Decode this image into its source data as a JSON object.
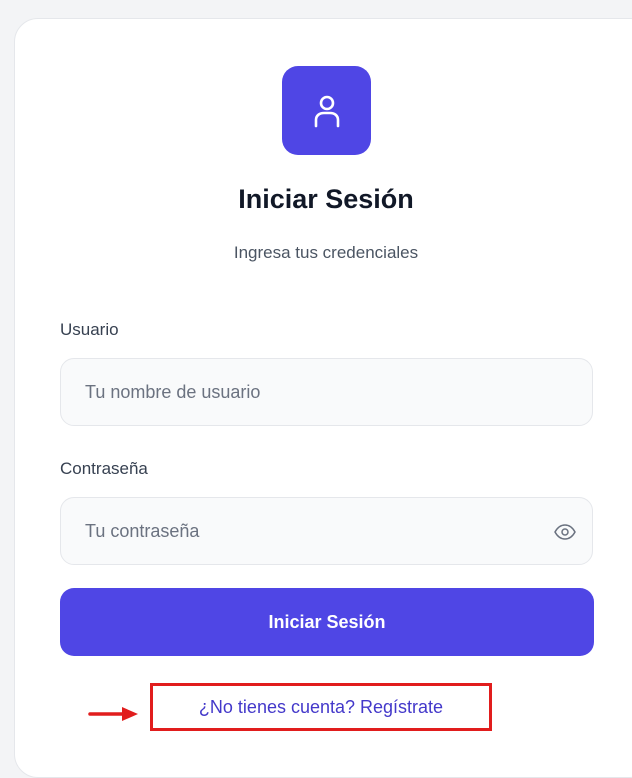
{
  "header": {
    "icon": "user-icon",
    "title": "Iniciar Sesión",
    "subtitle": "Ingresa tus credenciales"
  },
  "form": {
    "username": {
      "label": "Usuario",
      "placeholder": "Tu nombre de usuario",
      "value": ""
    },
    "password": {
      "label": "Contraseña",
      "placeholder": "Tu contraseña",
      "value": "",
      "toggle_icon": "eye-icon"
    },
    "submit_label": "Iniciar Sesión"
  },
  "footer": {
    "register_link": "¿No tienes cuenta? Regístrate"
  },
  "annotation": {
    "arrow_icon": "arrow-right-icon",
    "highlight_color": "#e11d1d"
  },
  "colors": {
    "accent": "#4f46e5",
    "link": "#4338ca"
  }
}
